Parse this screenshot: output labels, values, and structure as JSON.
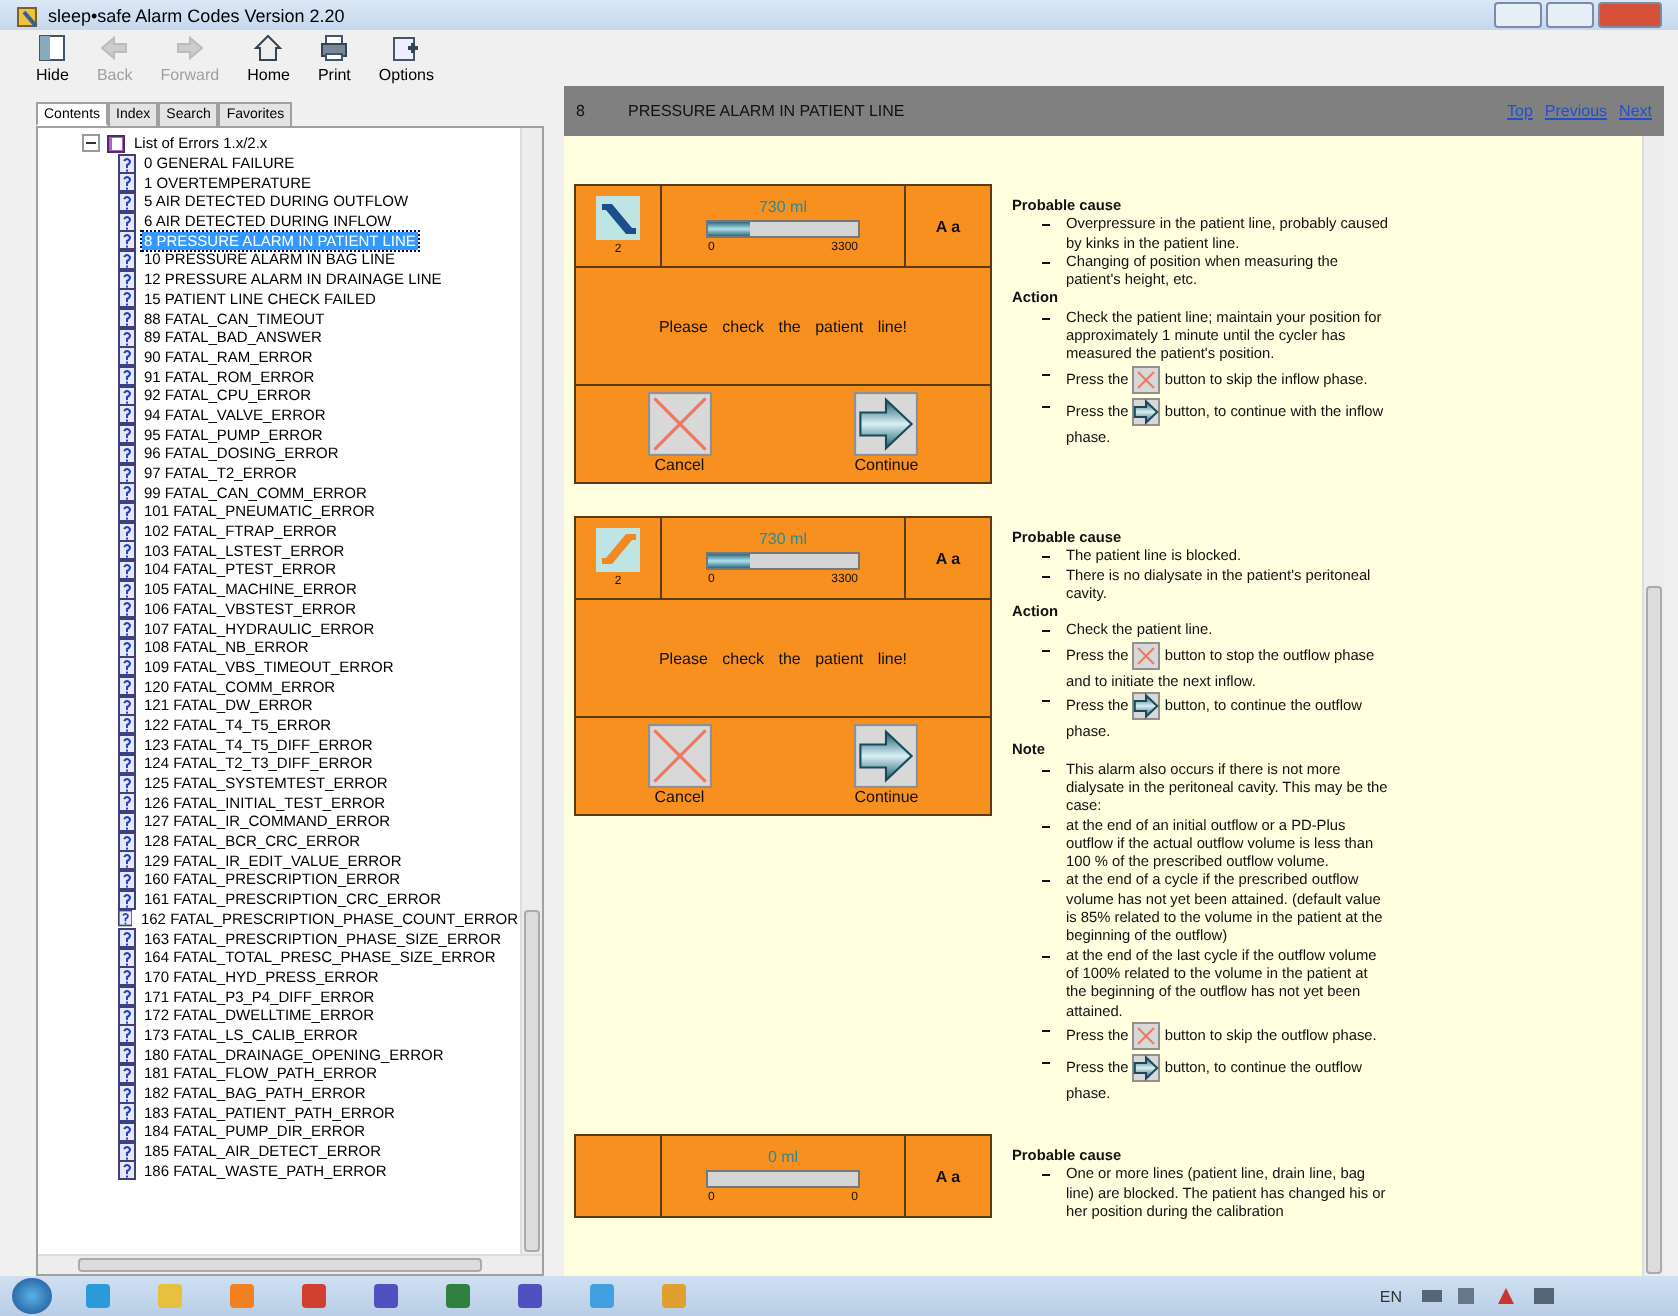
{
  "window": {
    "title": "sleep•safe Alarm Codes Version 2.20"
  },
  "taskbar": {
    "language": "EN"
  },
  "toolbar": [
    {
      "label": "Hide",
      "kind": "hide",
      "disabled": false
    },
    {
      "label": "Back",
      "kind": "back",
      "disabled": true
    },
    {
      "label": "Forward",
      "kind": "forward",
      "disabled": true
    },
    {
      "label": "Home",
      "kind": "home",
      "disabled": false
    },
    {
      "label": "Print",
      "kind": "print",
      "disabled": false
    },
    {
      "label": "Options",
      "kind": "options",
      "disabled": false
    }
  ],
  "nav_tabs": [
    {
      "label": "Contents",
      "selected": true
    },
    {
      "label": "Index",
      "selected": false
    },
    {
      "label": "Search",
      "selected": false
    },
    {
      "label": "Favorites",
      "selected": false
    }
  ],
  "tree": {
    "label": "List of Errors 1.x/2.x",
    "expanded": true,
    "children": [
      {
        "label": "0 GENERAL FAILURE",
        "selected": false
      },
      {
        "label": "1 OVERTEMPERATURE",
        "selected": false
      },
      {
        "label": "5 AIR DETECTED DURING OUTFLOW",
        "selected": false
      },
      {
        "label": "6 AIR DETECTED DURING INFLOW",
        "selected": false
      },
      {
        "label": "8 PRESSURE ALARM IN PATIENT LINE",
        "selected": true
      },
      {
        "label": "10 PRESSURE ALARM IN BAG LINE",
        "selected": false
      },
      {
        "label": "12 PRESSURE ALARM IN DRAINAGE LINE",
        "selected": false
      },
      {
        "label": "15 PATIENT LINE CHECK FAILED",
        "selected": false
      },
      {
        "label": "88 FATAL_CAN_TIMEOUT",
        "selected": false
      },
      {
        "label": "89 FATAL_BAD_ANSWER",
        "selected": false
      },
      {
        "label": "90 FATAL_RAM_ERROR",
        "selected": false
      },
      {
        "label": "91 FATAL_ROM_ERROR",
        "selected": false
      },
      {
        "label": "92 FATAL_CPU_ERROR",
        "selected": false
      },
      {
        "label": "94 FATAL_VALVE_ERROR",
        "selected": false
      },
      {
        "label": "95 FATAL_PUMP_ERROR",
        "selected": false
      },
      {
        "label": "96 FATAL_DOSING_ERROR",
        "selected": false
      },
      {
        "label": "97 FATAL_T2_ERROR",
        "selected": false
      },
      {
        "label": "99 FATAL_CAN_COMM_ERROR",
        "selected": false
      },
      {
        "label": "101 FATAL_PNEUMATIC_ERROR",
        "selected": false
      },
      {
        "label": "102 FATAL_FTRAP_ERROR",
        "selected": false
      },
      {
        "label": "103 FATAL_LSTEST_ERROR",
        "selected": false
      },
      {
        "label": "104 FATAL_PTEST_ERROR",
        "selected": false
      },
      {
        "label": "105 FATAL_MACHINE_ERROR",
        "selected": false
      },
      {
        "label": "106 FATAL_VBSTEST_ERROR",
        "selected": false
      },
      {
        "label": "107 FATAL_HYDRAULIC_ERROR",
        "selected": false
      },
      {
        "label": "108 FATAL_NB_ERROR",
        "selected": false
      },
      {
        "label": "109 FATAL_VBS_TIMEOUT_ERROR",
        "selected": false
      },
      {
        "label": "120 FATAL_COMM_ERROR",
        "selected": false
      },
      {
        "label": "121 FATAL_DW_ERROR",
        "selected": false
      },
      {
        "label": "122 FATAL_T4_T5_ERROR",
        "selected": false
      },
      {
        "label": "123 FATAL_T4_T5_DIFF_ERROR",
        "selected": false
      },
      {
        "label": "124 FATAL_T2_T3_DIFF_ERROR",
        "selected": false
      },
      {
        "label": "125 FATAL_SYSTEMTEST_ERROR",
        "selected": false
      },
      {
        "label": "126 FATAL_INITIAL_TEST_ERROR",
        "selected": false
      },
      {
        "label": "127 FATAL_IR_COMMAND_ERROR",
        "selected": false
      },
      {
        "label": "128 FATAL_BCR_CRC_ERROR",
        "selected": false
      },
      {
        "label": "129 FATAL_IR_EDIT_VALUE_ERROR",
        "selected": false
      },
      {
        "label": "160 FATAL_PRESCRIPTION_ERROR",
        "selected": false
      },
      {
        "label": "161 FATAL_PRESCRIPTION_CRC_ERROR",
        "selected": false
      },
      {
        "label": "162 FATAL_PRESCRIPTION_PHASE_COUNT_ERROR",
        "selected": false
      },
      {
        "label": "163 FATAL_PRESCRIPTION_PHASE_SIZE_ERROR",
        "selected": false
      },
      {
        "label": "164 FATAL_TOTAL_PRESC_PHASE_SIZE_ERROR",
        "selected": false
      },
      {
        "label": "170 FATAL_HYD_PRESS_ERROR",
        "selected": false
      },
      {
        "label": "171 FATAL_P3_P4_DIFF_ERROR",
        "selected": false
      },
      {
        "label": "172 FATAL_DWELLTIME_ERROR",
        "selected": false
      },
      {
        "label": "173 FATAL_LS_CALIB_ERROR",
        "selected": false
      },
      {
        "label": "180 FATAL_DRAINAGE_OPENING_ERROR",
        "selected": false
      },
      {
        "label": "181 FATAL_FLOW_PATH_ERROR",
        "selected": false
      },
      {
        "label": "182 FATAL_BAG_PATH_ERROR",
        "selected": false
      },
      {
        "label": "183 FATAL_PATIENT_PATH_ERROR",
        "selected": false
      },
      {
        "label": "184 FATAL_PUMP_DIR_ERROR",
        "selected": false
      },
      {
        "label": "185 FATAL_AIR_DETECT_ERROR",
        "selected": false
      },
      {
        "label": "186 FATAL_WASTE_PATH_ERROR",
        "selected": false
      }
    ]
  },
  "topic": {
    "number": "8",
    "title": "PRESSURE ALARM IN PATIENT LINE",
    "links": [
      "Top",
      "Previous",
      "Next"
    ]
  },
  "sections": [
    {
      "screen": {
        "indicator": {
          "kind": "line-down"
        },
        "cycle": "2",
        "min": "0",
        "max": "3300",
        "level": 0.28,
        "volume": "730 ml",
        "font_label": "A a",
        "message": "Please check the patient line!",
        "buttons": [
          {
            "label": "Cancel",
            "kind": "cancel"
          },
          {
            "label": "Continue",
            "kind": "continue"
          }
        ]
      },
      "blocks": [
        {
          "kind": "heading",
          "text": "Probable cause"
        },
        {
          "kind": "bullet",
          "text": "Overpressure in the patient line, probably caused by kinks in the patient line."
        },
        {
          "kind": "bullet",
          "text": "Changing of position when measuring the patient's height, etc."
        },
        {
          "kind": "heading",
          "text": "Action"
        },
        {
          "kind": "bullet",
          "text": "Check the patient line; maintain your position for approximately 1 minute until the cycler has measured the patient's position."
        },
        {
          "kind": "bullet",
          "parts": [
            {
              "kind": "text",
              "text": "Press the"
            },
            {
              "kind": "cancel"
            },
            {
              "kind": "text",
              "text": "button to skip the inflow phase."
            }
          ]
        },
        {
          "kind": "bullet",
          "parts": [
            {
              "kind": "text",
              "text": "Press the"
            },
            {
              "kind": "continue"
            },
            {
              "kind": "text",
              "text": "button, to continue with the inflow phase."
            }
          ]
        }
      ]
    },
    {
      "screen": {
        "indicator": {
          "kind": "line-up"
        },
        "cycle": "2",
        "min": "0",
        "max": "3300",
        "level": 0.28,
        "volume": "730 ml",
        "font_label": "A a",
        "message": "Please check the patient line!",
        "buttons": [
          {
            "label": "Cancel",
            "kind": "cancel"
          },
          {
            "label": "Continue",
            "kind": "continue"
          }
        ]
      },
      "blocks": [
        {
          "kind": "heading",
          "text": "Probable cause"
        },
        {
          "kind": "bullet",
          "text": "The patient line is blocked."
        },
        {
          "kind": "bullet",
          "text": "There is no dialysate in the patient's peritoneal cavity."
        },
        {
          "kind": "heading",
          "text": "Action"
        },
        {
          "kind": "bullet",
          "text": "Check the patient line."
        },
        {
          "kind": "bullet",
          "parts": [
            {
              "kind": "text",
              "text": "Press the"
            },
            {
              "kind": "cancel"
            },
            {
              "kind": "text",
              "text": "button to stop the outflow phase and to initiate the next inflow."
            }
          ]
        },
        {
          "kind": "bullet",
          "parts": [
            {
              "kind": "text",
              "text": "Press the"
            },
            {
              "kind": "continue"
            },
            {
              "kind": "text",
              "text": "button, to continue the outflow phase."
            }
          ]
        },
        {
          "kind": "heading",
          "text": "Note"
        },
        {
          "kind": "bullet",
          "text": "This alarm also occurs if there is not more dialysate in the peritoneal cavity. This may be the case:"
        },
        {
          "kind": "bullet",
          "text": "at the end of an initial outflow or a PD-Plus outflow if the actual outflow volume is less than 100 % of the prescribed outflow volume."
        },
        {
          "kind": "bullet",
          "text": "at the end of a cycle if the prescribed outflow volume has not yet been attained. (default value is 85% related to the volume in the patient at the beginning of the outflow)"
        },
        {
          "kind": "bullet",
          "text": "at the end of the last cycle if the outflow volume of 100% related to the volume in the patient at the beginning of the outflow has not yet been attained."
        },
        {
          "kind": "bullet",
          "parts": [
            {
              "kind": "text",
              "text": "Press the"
            },
            {
              "kind": "cancel"
            },
            {
              "kind": "text",
              "text": "button to skip the outflow phase."
            }
          ]
        },
        {
          "kind": "bullet",
          "parts": [
            {
              "kind": "text",
              "text": "Press the"
            },
            {
              "kind": "continue"
            },
            {
              "kind": "text",
              "text": "button, to continue the outflow phase."
            }
          ]
        }
      ]
    },
    {
      "screen": {
        "min": "0",
        "max": "0",
        "level": 0,
        "volume": "0 ml",
        "font_label": "A a"
      },
      "blocks": [
        {
          "kind": "heading",
          "text": "Probable cause"
        },
        {
          "kind": "bullet",
          "text": "One or more lines (patient line, drain line, bag line) are blocked. The patient has changed his or her position during the calibration"
        }
      ]
    }
  ]
}
